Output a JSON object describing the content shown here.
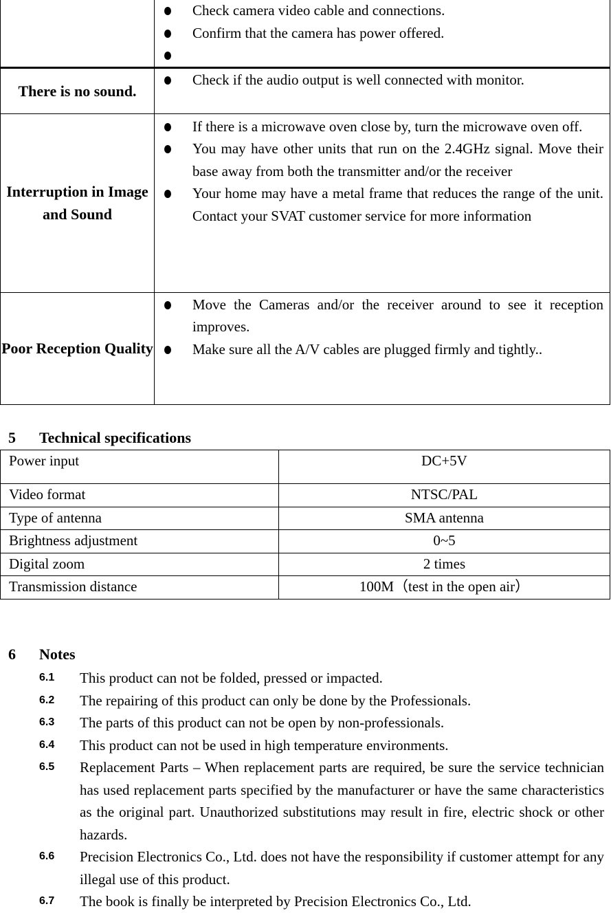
{
  "troubleshooting": {
    "rows": [
      {
        "problem": "",
        "solutions": [
          "Check camera video cable and connections.",
          "Confirm that the camera has power offered.",
          ""
        ]
      },
      {
        "problem": "There is no sound.",
        "solutions": [
          "Check if the audio output is well connected with monitor."
        ]
      },
      {
        "problem": "Interruption in Image and Sound",
        "solutions": [
          "If there is a microwave oven close by, turn the microwave oven off.",
          "You may have other units that run on the 2.4GHz signal. Move their base away from both the transmitter and/or the receiver",
          "Your home may have a metal frame that reduces the range of the unit. Contact your SVAT customer service for more information"
        ]
      },
      {
        "problem": "Poor Reception Quality",
        "solutions": [
          "Move the Cameras and/or the receiver around to see it reception improves.",
          "Make sure all the A/V cables are plugged firmly and tightly.."
        ]
      }
    ]
  },
  "spec_section": {
    "number": "5",
    "title": "Technical specifications",
    "rows": [
      {
        "key": "Power input",
        "value": "DC+5V"
      },
      {
        "key": "Video format",
        "value": "NTSC/PAL"
      },
      {
        "key": "Type of antenna",
        "value": "SMA antenna"
      },
      {
        "key": "Brightness adjustment",
        "value": "0~5"
      },
      {
        "key": "Digital zoom",
        "value": "2 times"
      },
      {
        "key": "Transmission distance",
        "value": "100M（test in the open air）"
      }
    ]
  },
  "notes_section": {
    "number": "6",
    "title": "Notes",
    "items": [
      {
        "num": "6.1",
        "text": "This product can not be folded, pressed or impacted."
      },
      {
        "num": "6.2",
        "text": "The repairing of this product can only be done by the Professionals."
      },
      {
        "num": "6.3",
        "text": "The parts of this product can not be open by non-professionals."
      },
      {
        "num": "6.4",
        "text": "This product can not be used in high temperature environments."
      },
      {
        "num": "6.5",
        "text": "Replacement Parts – When replacement parts are required, be sure the service technician has used replacement parts specified by the manufacturer or have the same characteristics as the original part. Unauthorized substitutions may result in fire, electric shock or other hazards."
      },
      {
        "num": "6.6",
        "text": "Precision Electronics Co., Ltd. does not have the responsibility if customer attempt for any illegal use of this product."
      },
      {
        "num": "6.7",
        "text": "The book is finally be interpreted by Precision Electronics Co., Ltd."
      }
    ]
  }
}
